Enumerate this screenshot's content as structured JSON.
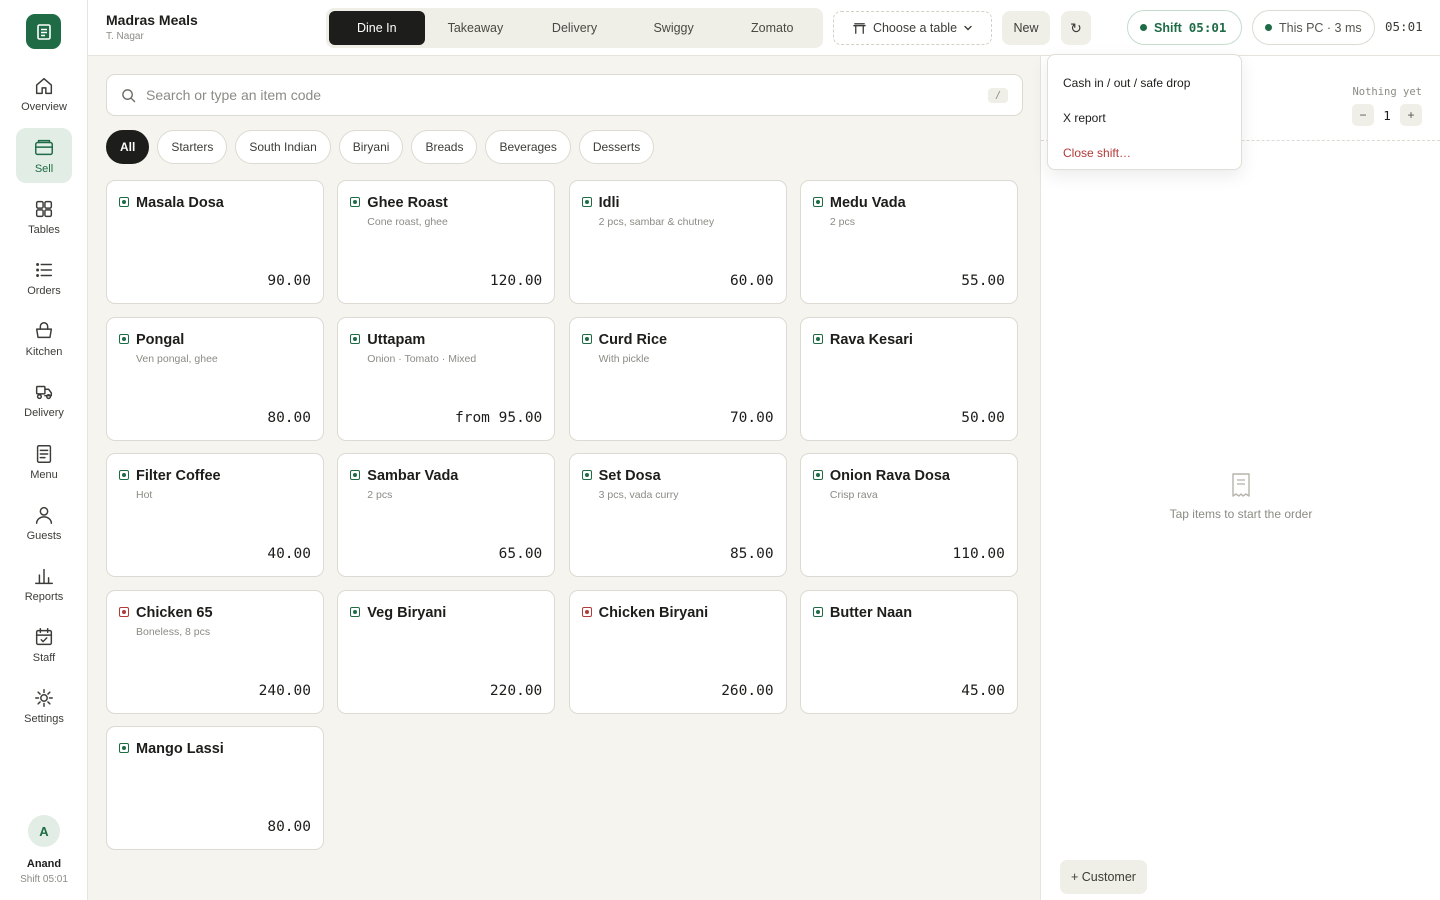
{
  "colors": {
    "brand": "#1f6b45",
    "danger": "#b23a3a",
    "background": "#f5f4ee"
  },
  "store": {
    "name": "Madras Meals",
    "location": "T. Nagar"
  },
  "modes": [
    {
      "label": "Dine In",
      "active": true
    },
    {
      "label": "Takeaway"
    },
    {
      "label": "Delivery"
    },
    {
      "label": "Swiggy"
    },
    {
      "label": "Zomato"
    }
  ],
  "header": {
    "table_label": "Choose a table",
    "new_label": "New",
    "refresh_icon": "↻",
    "shift_label": "Shift",
    "shift_time": "05:01",
    "pc_status": "This PC · 3 ms",
    "clock": "05:01"
  },
  "sidebar": {
    "items": [
      {
        "label": "Overview",
        "icon": "home-icon"
      },
      {
        "label": "Sell",
        "icon": "register-icon",
        "active": true
      },
      {
        "label": "Tables",
        "icon": "grid-icon"
      },
      {
        "label": "Orders",
        "icon": "list-icon"
      },
      {
        "label": "Kitchen",
        "icon": "basket-icon"
      },
      {
        "label": "Delivery",
        "icon": "scooter-icon"
      },
      {
        "label": "Menu",
        "icon": "menu-icon"
      },
      {
        "label": "Guests",
        "icon": "person-icon"
      },
      {
        "label": "Reports",
        "icon": "bar-chart-icon"
      },
      {
        "label": "Staff",
        "icon": "calendar-icon"
      },
      {
        "label": "Settings",
        "icon": "sun-gear-icon"
      }
    ],
    "user": {
      "initial": "A",
      "name": "Anand",
      "shift": "Shift 05:01"
    }
  },
  "search": {
    "placeholder": "Search or type an item code",
    "shortcut": "/"
  },
  "categories": [
    {
      "label": "All",
      "active": true
    },
    {
      "label": "Starters"
    },
    {
      "label": "South Indian"
    },
    {
      "label": "Biryani"
    },
    {
      "label": "Breads"
    },
    {
      "label": "Beverages"
    },
    {
      "label": "Desserts"
    }
  ],
  "items": [
    {
      "name": "Masala Dosa",
      "desc": "",
      "price": "90.00",
      "veg": true
    },
    {
      "name": "Ghee Roast",
      "desc": "Cone roast, ghee",
      "price": "120.00",
      "veg": true
    },
    {
      "name": "Idli",
      "desc": "2 pcs, sambar & chutney",
      "price": "60.00",
      "veg": true
    },
    {
      "name": "Medu Vada",
      "desc": "2 pcs",
      "price": "55.00",
      "veg": true
    },
    {
      "name": "Pongal",
      "desc": "Ven pongal, ghee",
      "price": "80.00",
      "veg": true
    },
    {
      "name": "Uttapam",
      "desc": "Onion · Tomato · Mixed",
      "price": "from 95.00",
      "veg": true
    },
    {
      "name": "Curd Rice",
      "desc": "With pickle",
      "price": "70.00",
      "veg": true
    },
    {
      "name": "Rava Kesari",
      "desc": "",
      "price": "50.00",
      "veg": true
    },
    {
      "name": "Filter Coffee",
      "desc": "Hot",
      "price": "40.00",
      "veg": true
    },
    {
      "name": "Sambar Vada",
      "desc": "2 pcs",
      "price": "65.00",
      "veg": true
    },
    {
      "name": "Set Dosa",
      "desc": "3 pcs, vada curry",
      "price": "85.00",
      "veg": true
    },
    {
      "name": "Onion Rava Dosa",
      "desc": "Crisp rava",
      "price": "110.00",
      "veg": true
    },
    {
      "name": "Chicken 65",
      "desc": "Boneless, 8 pcs",
      "price": "240.00",
      "veg": false
    },
    {
      "name": "Veg Biryani",
      "desc": "",
      "price": "220.00",
      "veg": true
    },
    {
      "name": "Chicken Biryani",
      "desc": "",
      "price": "260.00",
      "veg": false
    },
    {
      "name": "Butter Naan",
      "desc": "",
      "price": "45.00",
      "veg": true
    },
    {
      "name": "Mango Lassi",
      "desc": "",
      "price": "80.00",
      "veg": true
    }
  ],
  "order": {
    "status": "Nothing yet",
    "qty": "1",
    "minus": "−",
    "plus": "+",
    "empty_text": "Tap items to start the order",
    "customer_label": "+ Customer"
  },
  "shift_menu": [
    {
      "label": "Cash in / out / safe drop"
    },
    {
      "label": "X report"
    },
    {
      "label": "Close shift…",
      "danger": true
    }
  ]
}
